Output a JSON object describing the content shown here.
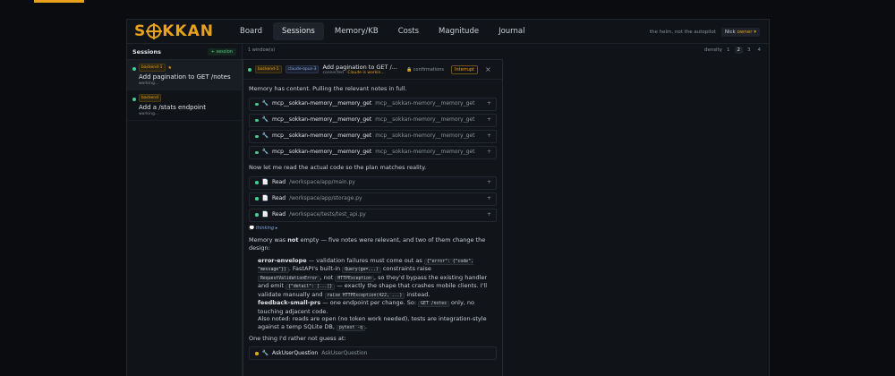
{
  "brand": {
    "name_left": "S",
    "name_mid": "KKAN"
  },
  "nav": [
    {
      "label": "Board"
    },
    {
      "label": "Sessions"
    },
    {
      "label": "Memory/KB"
    },
    {
      "label": "Costs"
    },
    {
      "label": "Magnitude"
    },
    {
      "label": "Journal"
    }
  ],
  "header": {
    "tagline": "the helm, not the autopilot",
    "user": "Nick",
    "role": "owner ▾"
  },
  "sidebar": {
    "title": "Sessions",
    "new_label": "+ session",
    "sessions": [
      {
        "tag": "backend-1",
        "star": "★",
        "title": "Add pagination to GET /notes",
        "status": "working..."
      },
      {
        "tag": "backend",
        "star": "",
        "title": "Add a /stats endpoint",
        "status": "working..."
      }
    ]
  },
  "toolbar": {
    "windows": "1 window(s)",
    "density_label": "density",
    "density_options": [
      "1",
      "2",
      "3",
      "4"
    ],
    "density_selected": "2"
  },
  "window": {
    "tag1": "backend-1",
    "tag2": "claude-opus-3",
    "title": "Add pagination to GET /...",
    "sub_connected": "connected · ",
    "sub_status": "Claude is workin...",
    "confirmations": "🔒 confirmations",
    "interrupt": "Interrupt",
    "close": "×"
  },
  "content": {
    "p1": "Memory has content. Pulling the relevant notes in full.",
    "memory_tools": [
      {
        "name": "mcp__sokkan-memory__memory_get",
        "arg": "mcp__sokkan-memory__memory_get"
      },
      {
        "name": "mcp__sokkan-memory__memory_get",
        "arg": "mcp__sokkan-memory__memory_get"
      },
      {
        "name": "mcp__sokkan-memory__memory_get",
        "arg": "mcp__sokkan-memory__memory_get"
      },
      {
        "name": "mcp__sokkan-memory__memory_get",
        "arg": "mcp__sokkan-memory__memory_get"
      }
    ],
    "p2": "Now let me read the actual code so the plan matches reality.",
    "read_tools": [
      {
        "name": "Read",
        "arg": "/workspace/app/main.py"
      },
      {
        "name": "Read",
        "arg": "/workspace/app/storage.py"
      },
      {
        "name": "Read",
        "arg": "/workspace/tests/test_api.py"
      }
    ],
    "thinking_icon": "💭",
    "thinking": "thinking ▸",
    "p3_a": "Memory was ",
    "p3_b": "not",
    "p3_c": " empty — five notes were relevant, and two of them change the design:",
    "b1_title": "error-envelope",
    "b1_a": " — validation failures must come out as ",
    "b1_code1": "{\"error\": {\"code\", \"message\"}}",
    "b1_b": ". FastAPI's built-in ",
    "b1_code2": "Query(ge=...)",
    "b1_c": " constraints raise ",
    "b1_code3": "RequestValidationError",
    "b1_d": ", not ",
    "b1_code4": "HTTPException",
    "b1_e": ", so they'd bypass the existing handler and emit ",
    "b1_code5": "{\"detail\": [...]}",
    "b1_f": " — exactly the shape that crashes mobile clients. I'll validate manually and ",
    "b1_code6": "raise HTTPException(422, ...)",
    "b1_g": " instead.",
    "b2_title": "feedback-small-prs",
    "b2_a": " — one endpoint per change. So: ",
    "b2_code": "GET /notes",
    "b2_b": " only, no touching adjacent code.",
    "b3_a": "Also noted: reads are open (no token work needed), tests are integration-style against a temp SQLite DB, ",
    "b3_code": "pytest -q",
    "b3_b": ".",
    "p4": "One thing I'd rather not guess at:",
    "ask_tool": {
      "name": "AskUserQuestion",
      "arg": "AskUserQuestion"
    },
    "plus": "+"
  }
}
